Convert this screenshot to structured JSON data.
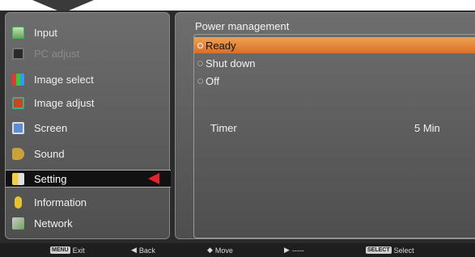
{
  "menu": {
    "items": [
      {
        "label": "Input",
        "icon": "input-icon",
        "state": "normal"
      },
      {
        "label": "PC adjust",
        "icon": "pc-adjust-icon",
        "state": "disabled"
      },
      {
        "label": "Image select",
        "icon": "image-select-icon",
        "state": "normal"
      },
      {
        "label": "Image adjust",
        "icon": "image-adjust-icon",
        "state": "normal"
      },
      {
        "label": "Screen",
        "icon": "screen-icon",
        "state": "normal"
      },
      {
        "label": "Sound",
        "icon": "sound-icon",
        "state": "normal"
      },
      {
        "label": "Setting",
        "icon": "setting-icon",
        "state": "selected"
      },
      {
        "label": "Information",
        "icon": "information-icon",
        "state": "normal"
      },
      {
        "label": "Network",
        "icon": "network-icon",
        "state": "normal"
      }
    ],
    "pointer_color": "#e8222c"
  },
  "panel": {
    "title": "Power management",
    "options": [
      {
        "label": "Ready",
        "selected": true
      },
      {
        "label": "Shut down",
        "selected": false
      },
      {
        "label": "Off",
        "selected": false
      }
    ],
    "timer_label": "Timer",
    "timer_value": "5 Min",
    "highlight_color": "#e88a3c"
  },
  "footer": {
    "exit_key": "MENU",
    "exit": "Exit",
    "back_glyph": "◀",
    "back": "Back",
    "move_glyph": "◆",
    "move": "Move",
    "next_glyph": "▶",
    "next": "-----",
    "select_key": "SELECT",
    "select": "Select"
  }
}
